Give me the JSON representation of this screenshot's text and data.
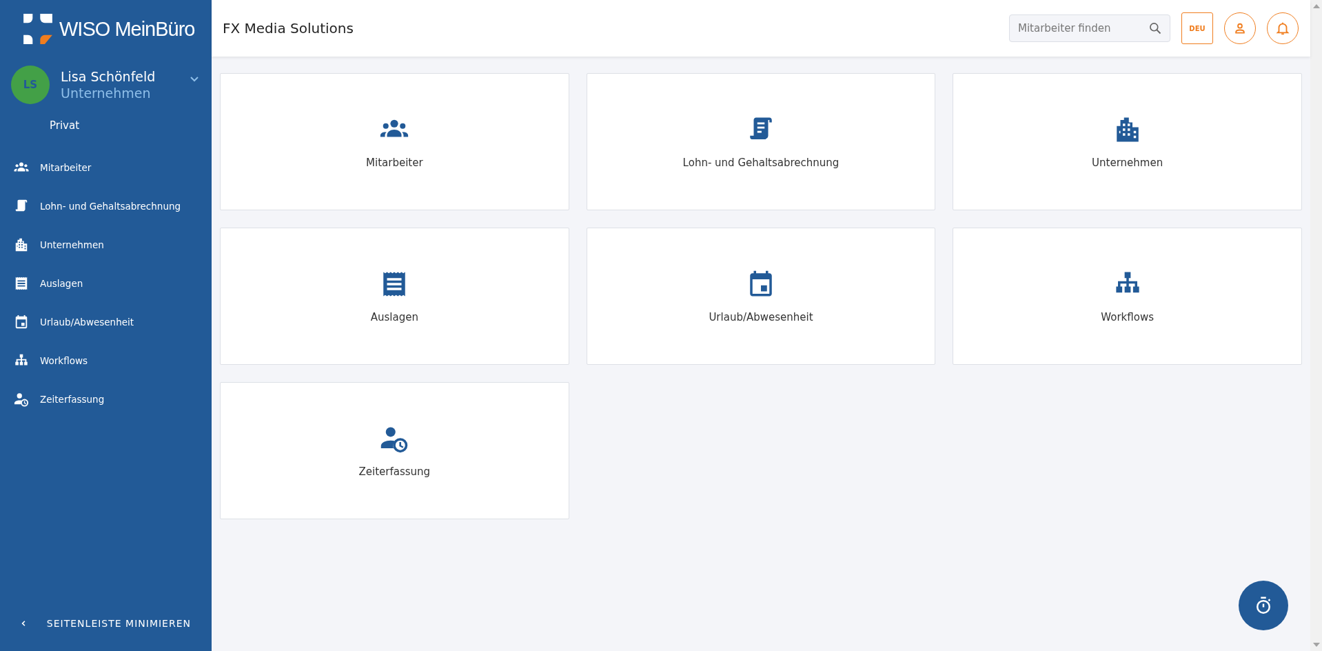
{
  "brand": {
    "name": "WISO MeinBüro"
  },
  "user": {
    "initials": "LS",
    "name": "Lisa Schönfeld",
    "company": "Unternehmen",
    "options": [
      "Privat"
    ]
  },
  "sidebar": {
    "items": [
      {
        "label": "Mitarbeiter"
      },
      {
        "label": "Lohn- und Gehaltsabrechnung"
      },
      {
        "label": "Unternehmen"
      },
      {
        "label": "Auslagen"
      },
      {
        "label": "Urlaub/Abwesenheit"
      },
      {
        "label": "Workflows"
      },
      {
        "label": "Zeiterfassung"
      }
    ],
    "collapse": "SEITENLEISTE MINIMIEREN"
  },
  "header": {
    "title": "FX Media Solutions",
    "search": {
      "placeholder": "Mitarbeiter finden"
    },
    "language": "DEU"
  },
  "tiles": [
    {
      "label": "Mitarbeiter"
    },
    {
      "label": "Lohn- und Gehaltsabrechnung"
    },
    {
      "label": "Unternehmen"
    },
    {
      "label": "Auslagen"
    },
    {
      "label": "Urlaub/Abwesenheit"
    },
    {
      "label": "Workflows"
    },
    {
      "label": "Zeiterfassung"
    }
  ]
}
